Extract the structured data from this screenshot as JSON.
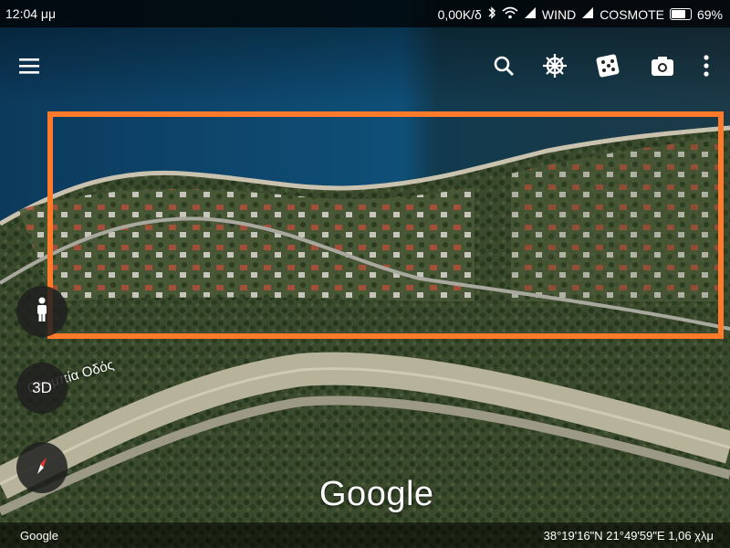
{
  "status_bar": {
    "time": "12:04 μμ",
    "speed": "0,00K/δ",
    "carrier1": "WIND",
    "carrier2": "COSMOTE",
    "battery_percent": "69%",
    "battery_level": 0.69
  },
  "toolbar": {
    "menu_icon": "menu-icon",
    "search_icon": "search-icon",
    "voyager_icon": "ship-wheel-icon",
    "random_icon": "dice-icon",
    "snapshot_icon": "camera-icon",
    "more_icon": "more-vert-icon"
  },
  "map": {
    "road_label": "Ολυμπία Οδός",
    "logo": "Google",
    "highlight_color": "#ff7a2a"
  },
  "controls": {
    "pegman_icon": "pegman-icon",
    "toggle_3d_label": "3D",
    "compass_icon": "compass-icon"
  },
  "bottom_bar": {
    "attribution": "Google",
    "coordinates": "38°19'16\"N 21°49'59\"E 1,06 χλμ"
  }
}
